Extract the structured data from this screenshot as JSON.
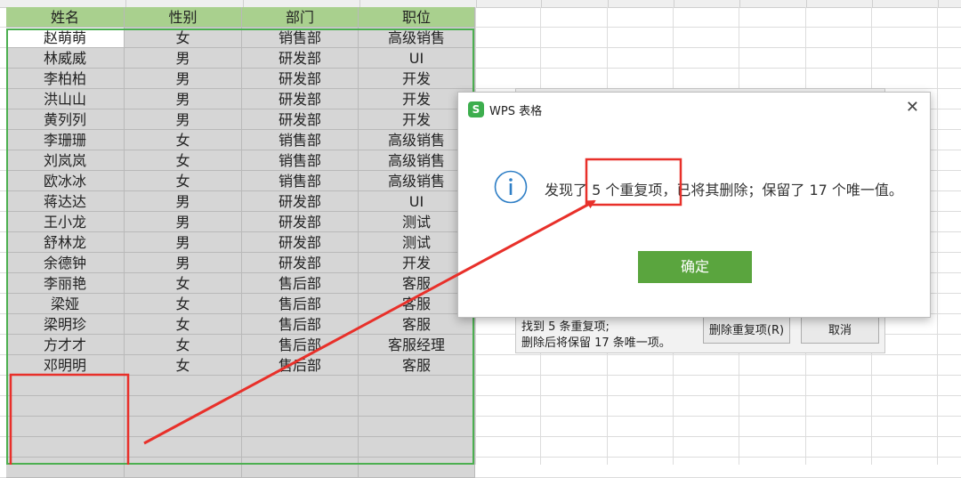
{
  "sheet": {
    "headers": [
      "姓名",
      "性别",
      "部门",
      "职位"
    ],
    "rows": [
      [
        "赵萌萌",
        "女",
        "销售部",
        "高级销售"
      ],
      [
        "林威威",
        "男",
        "研发部",
        "UI"
      ],
      [
        "李柏柏",
        "男",
        "研发部",
        "开发"
      ],
      [
        "洪山山",
        "男",
        "研发部",
        "开发"
      ],
      [
        "黄列列",
        "男",
        "研发部",
        "开发"
      ],
      [
        "李珊珊",
        "女",
        "销售部",
        "高级销售"
      ],
      [
        "刘岚岚",
        "女",
        "销售部",
        "高级销售"
      ],
      [
        "欧冰冰",
        "女",
        "销售部",
        "高级销售"
      ],
      [
        "蒋达达",
        "男",
        "研发部",
        "UI"
      ],
      [
        "王小龙",
        "男",
        "研发部",
        "测试"
      ],
      [
        "舒林龙",
        "男",
        "研发部",
        "测试"
      ],
      [
        "余德钟",
        "男",
        "研发部",
        "开发"
      ],
      [
        "李丽艳",
        "女",
        "售后部",
        "客服"
      ],
      [
        "梁娅",
        "女",
        "售后部",
        "客服"
      ],
      [
        "梁明珍",
        "女",
        "售后部",
        "客服"
      ],
      [
        "方才才",
        "女",
        "售后部",
        "客服经理"
      ],
      [
        "邓明明",
        "女",
        "售后部",
        "客服"
      ]
    ],
    "header_color": "#a9d08e",
    "data_fill": "#d6d6d6",
    "selection_color": "#4caf50"
  },
  "underlying_dialog": {
    "line1": "找到 5 条重复项;",
    "line2": "删除后将保留 17 条唯一项。",
    "delete_button": "删除重复项(R)",
    "cancel_button": "取消"
  },
  "dialog": {
    "logo_letter": "S",
    "title": "WPS 表格",
    "close_icon": "close-icon",
    "info_icon": "info-icon",
    "message": "发现了 5 个重复项，已将其删除；保留了 17 个唯一值。",
    "ok_button": "确定",
    "ok_color": "#5aa53e"
  },
  "annotations": {
    "color": "#e8302a"
  }
}
